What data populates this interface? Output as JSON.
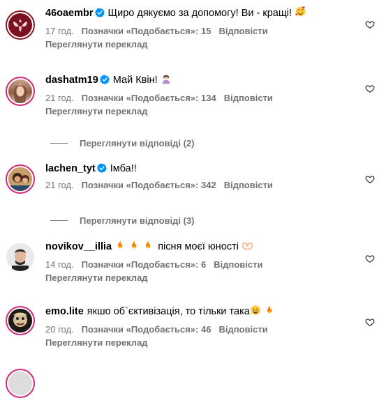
{
  "comments": [
    {
      "username": "46oaembr",
      "text": "Щиро дякуємо за допомогу! Ви - кращі!",
      "emoji": "smiling-hearts-emoji",
      "time": "17 год.",
      "likes": "Позначки «Подобається»: 15",
      "reply": "Відповісти",
      "translate": "Переглянути переклад"
    },
    {
      "username": "dashatm19",
      "text": "Май Квін!",
      "emoji": "woman-emoji",
      "time": "21 год.",
      "likes": "Позначки «Подобається»: 134",
      "reply": "Відповісти",
      "translate": "Переглянути переклад",
      "view_replies": "Переглянути відповіді (2)"
    },
    {
      "username": "lachen_tyt",
      "text": "Імба!!",
      "time": "21 год.",
      "likes": "Позначки «Подобається»: 342",
      "reply": "Відповісти",
      "view_replies": "Переглянути відповіді (3)"
    },
    {
      "username": "novikov__illia",
      "text": "пісня моєї юності",
      "emoji": "heart-hands-emoji",
      "time": "14 год.",
      "likes": "Позначки «Подобається»: 6",
      "reply": "Відповісти",
      "translate": "Переглянути переклад"
    },
    {
      "username": "emo.lite",
      "text": "якшо об`єктивізація, то тільки така",
      "time": "20 год.",
      "likes": "Позначки «Подобається»: 46",
      "reply": "Відповісти",
      "translate": "Переглянути переклад"
    }
  ],
  "colors": {
    "verified": "#0095f6",
    "muted": "#737373",
    "ring": "#d62976",
    "fire": "#f77b00"
  }
}
